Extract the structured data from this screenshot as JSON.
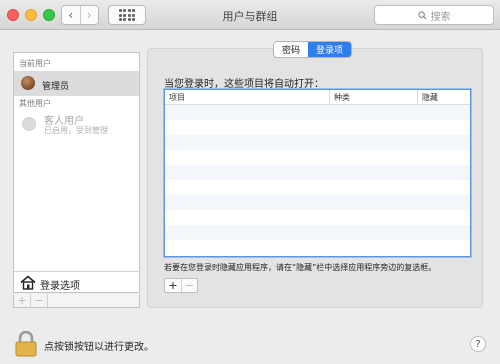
{
  "window": {
    "title": "用户与群组"
  },
  "toolbar": {
    "back_glyph": "‹",
    "forward_glyph": "›",
    "search_placeholder": "搜索"
  },
  "sidebar": {
    "current_users_heading": "当前用户",
    "admin_label": "管理员",
    "other_users_heading": "其他用户",
    "guest_name": "客人用户",
    "guest_status": "已启用，受到管理",
    "login_options_label": "登录选项",
    "add_glyph": "+",
    "remove_glyph": "−"
  },
  "tabs": [
    {
      "label": "密码",
      "active": false
    },
    {
      "label": "登录项",
      "active": true
    }
  ],
  "login_items": {
    "prompt": "当您登录时，这些项目将自动打开：",
    "columns": [
      "项目",
      "种类",
      "隐藏"
    ],
    "rows": [],
    "hint": "若要在您登录时隐藏应用程序，请在“隐藏”栏中选择应用程序旁边的复选框。",
    "add_glyph": "+",
    "remove_glyph": "−"
  },
  "footer": {
    "lock_text": "点按锁按钮以进行更改。",
    "help_glyph": "?"
  },
  "colors": {
    "accent": "#2f7ef0",
    "close": "#fc605c",
    "minimize": "#fdbc40",
    "maximize": "#34c84a"
  },
  "icons": [
    "search-icon",
    "grid-icon",
    "house-icon",
    "lock-icon",
    "help-icon"
  ]
}
